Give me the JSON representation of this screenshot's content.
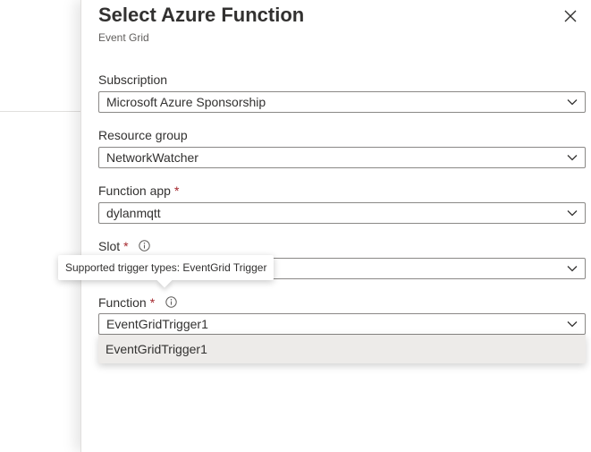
{
  "panel": {
    "title": "Select Azure Function",
    "subtitle": "Event Grid",
    "close_icon": "close-icon"
  },
  "fields": {
    "subscription": {
      "label": "Subscription",
      "value": "Microsoft Azure Sponsorship",
      "required": false
    },
    "resource_group": {
      "label": "Resource group",
      "value": "NetworkWatcher",
      "required": false
    },
    "function_app": {
      "label": "Function app",
      "value": "dylanmqtt",
      "required": true
    },
    "slot": {
      "label": "Slot",
      "value": "",
      "required": true,
      "info_icon": "info-icon"
    },
    "function": {
      "label": "Function",
      "value": "EventGridTrigger1",
      "required": true,
      "info_icon": "info-icon"
    }
  },
  "required_marker": "*",
  "dropdown": {
    "options": [
      "EventGridTrigger1"
    ]
  },
  "tooltip": {
    "text": "Supported trigger types: EventGrid Trigger"
  },
  "colors": {
    "required": "#a4262c",
    "border": "#8a8886",
    "option_hover": "#edebe9",
    "text": "#323130"
  }
}
